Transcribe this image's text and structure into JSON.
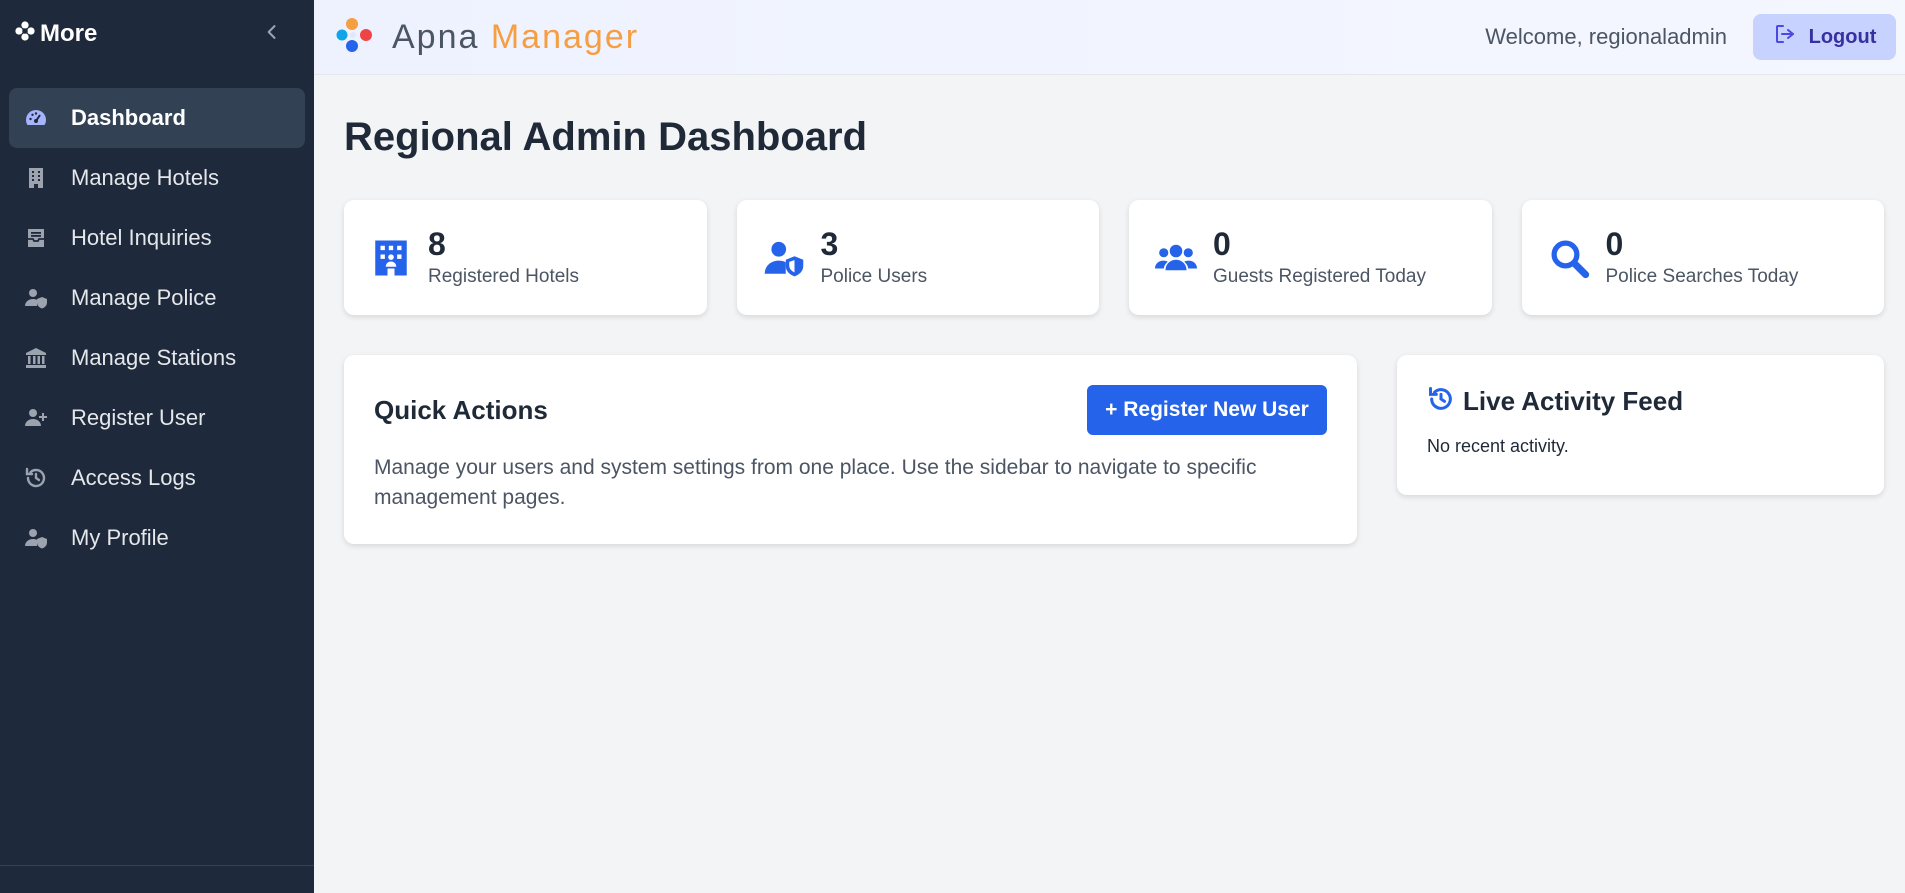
{
  "sidebar": {
    "brand": "More",
    "items": [
      {
        "label": "Dashboard",
        "icon": "dashboard-gauge-icon",
        "active": true
      },
      {
        "label": "Manage Hotels",
        "icon": "building-icon"
      },
      {
        "label": "Hotel Inquiries",
        "icon": "inbox-tray-icon"
      },
      {
        "label": "Manage Police",
        "icon": "user-shield-icon"
      },
      {
        "label": "Manage Stations",
        "icon": "landmark-icon"
      },
      {
        "label": "Register User",
        "icon": "user-plus-icon"
      },
      {
        "label": "Access Logs",
        "icon": "history-icon"
      },
      {
        "label": "My Profile",
        "icon": "user-shield-icon"
      }
    ]
  },
  "header": {
    "logo_part1": "Apna",
    "logo_part2": "Manager",
    "welcome": "Welcome, regionaladmin",
    "logout_label": "Logout"
  },
  "main": {
    "title": "Regional Admin Dashboard",
    "stats": [
      {
        "value": "8",
        "label": "Registered Hotels",
        "icon": "hotel-icon"
      },
      {
        "value": "3",
        "label": "Police Users",
        "icon": "user-shield-icon"
      },
      {
        "value": "0",
        "label": "Guests Registered Today",
        "icon": "users-icon"
      },
      {
        "value": "0",
        "label": "Police Searches Today",
        "icon": "search-icon"
      }
    ],
    "quick_actions": {
      "title": "Quick Actions",
      "button": "+ Register New User",
      "text": "Manage your users and system settings from one place. Use the sidebar to navigate to specific management pages."
    },
    "feed": {
      "title": "Live Activity Feed",
      "empty_text": "No recent activity."
    }
  },
  "colors": {
    "sidebar_bg": "#1e293b",
    "accent": "#2563eb",
    "logo_orange": "#f59e42",
    "logout_bg": "#c7d2fe"
  }
}
